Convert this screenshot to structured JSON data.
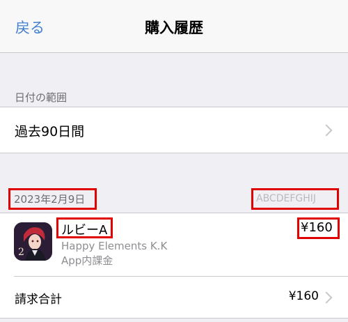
{
  "nav": {
    "back_label": "戻る",
    "title": "購入履歴"
  },
  "date_range": {
    "header": "日付の範囲",
    "value": "過去90日間"
  },
  "purchase": {
    "date": "2023年2月9日",
    "order_id": "ABCDEFGHIJ",
    "item": {
      "name": "ルビーA",
      "developer": "Happy Elements K.K",
      "type": "App内課金",
      "price": "¥160",
      "icon": "app-icon"
    },
    "total": {
      "label": "請求合計",
      "value": "¥160"
    }
  },
  "colors": {
    "accent": "#3f7fd3",
    "highlight": "#e00000",
    "background": "#efeff4"
  }
}
